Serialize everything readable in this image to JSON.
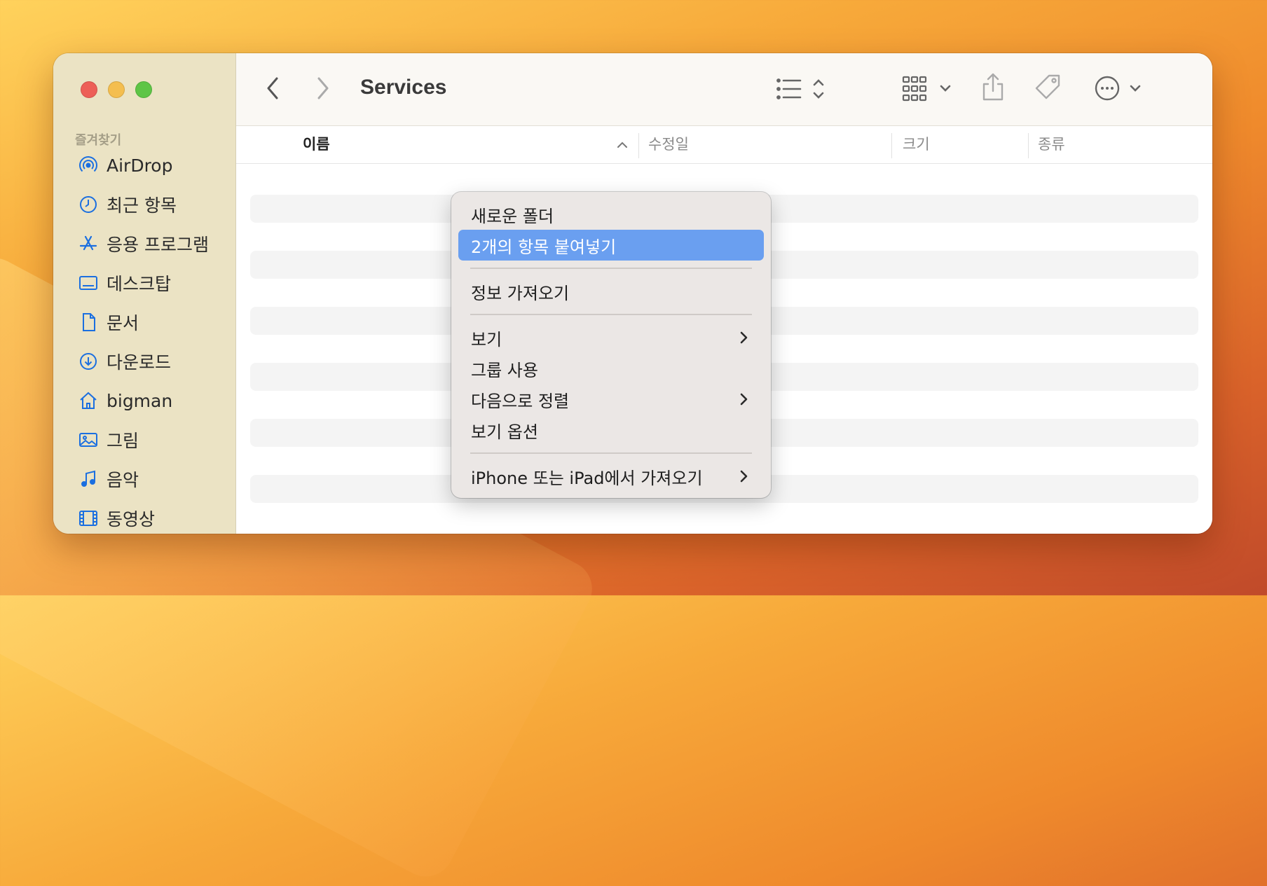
{
  "window": {
    "title": "Services"
  },
  "sidebar": {
    "section_label": "즐겨찾기",
    "items": [
      {
        "label": "AirDrop",
        "icon": "airdrop-icon"
      },
      {
        "label": "최근 항목",
        "icon": "clock-icon"
      },
      {
        "label": "응용 프로그램",
        "icon": "applications-icon"
      },
      {
        "label": "데스크탑",
        "icon": "desktop-icon"
      },
      {
        "label": "문서",
        "icon": "document-icon"
      },
      {
        "label": "다운로드",
        "icon": "download-icon"
      },
      {
        "label": "bigman",
        "icon": "home-icon"
      },
      {
        "label": "그림",
        "icon": "pictures-icon"
      },
      {
        "label": "음악",
        "icon": "music-icon"
      },
      {
        "label": "동영상",
        "icon": "film-icon"
      }
    ]
  },
  "columns": {
    "name": "이름",
    "modified": "수정일",
    "size": "크기",
    "kind": "종류"
  },
  "context_menu": {
    "items": [
      {
        "label": "새로운 폴더",
        "highlighted": false,
        "submenu": false
      },
      {
        "label": "2개의 항목 붙여넣기",
        "highlighted": true,
        "submenu": false
      },
      {
        "label": "정보 가져오기",
        "highlighted": false,
        "submenu": false
      },
      {
        "label": "보기",
        "highlighted": false,
        "submenu": true
      },
      {
        "label": "그룹 사용",
        "highlighted": false,
        "submenu": false
      },
      {
        "label": "다음으로 정렬",
        "highlighted": false,
        "submenu": true
      },
      {
        "label": "보기 옵션",
        "highlighted": false,
        "submenu": false
      },
      {
        "label": "iPhone 또는 iPad에서 가져오기",
        "highlighted": false,
        "submenu": true
      }
    ]
  },
  "colors": {
    "accent": "#1b6fe0",
    "menu_highlight": "#6a9ff0",
    "sidebar_bg": "#ebe3c4"
  }
}
